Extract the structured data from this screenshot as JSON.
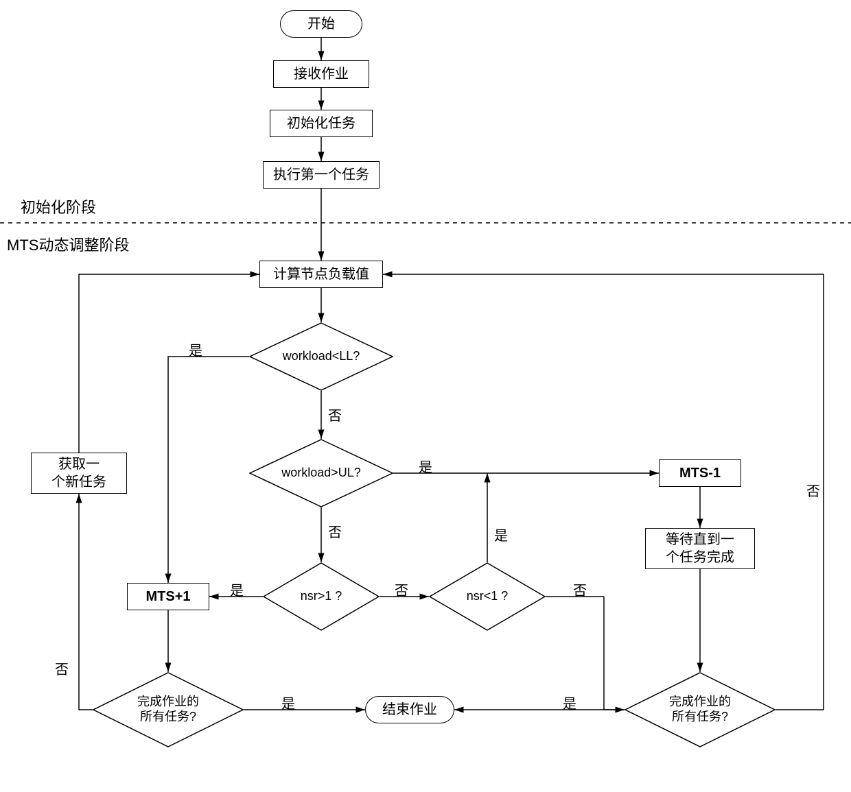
{
  "phases": {
    "init": "初始化阶段",
    "mts": "MTS动态调整阶段"
  },
  "nodes": {
    "start": "开始",
    "receive": "接收作业",
    "initTask": "初始化任务",
    "execFirst": "执行第一个任务",
    "calcLoad": "计算节点负载值",
    "workloadLL": "workload<LL?",
    "workloadUL": "workload>UL?",
    "nsrGT1": "nsr>1 ?",
    "nsrLT1": "nsr<1 ?",
    "mtsPlus": "MTS+1",
    "mtsMinus": "MTS-1",
    "getNew": "获取一\n个新任务",
    "waitDone": "等待直到一\n个任务完成",
    "allDoneLeft": "完成作业的\n所有任务?",
    "allDoneRight": "完成作业的\n所有任务?",
    "endJob": "结束作业"
  },
  "edges": {
    "yes": "是",
    "no": "否"
  }
}
